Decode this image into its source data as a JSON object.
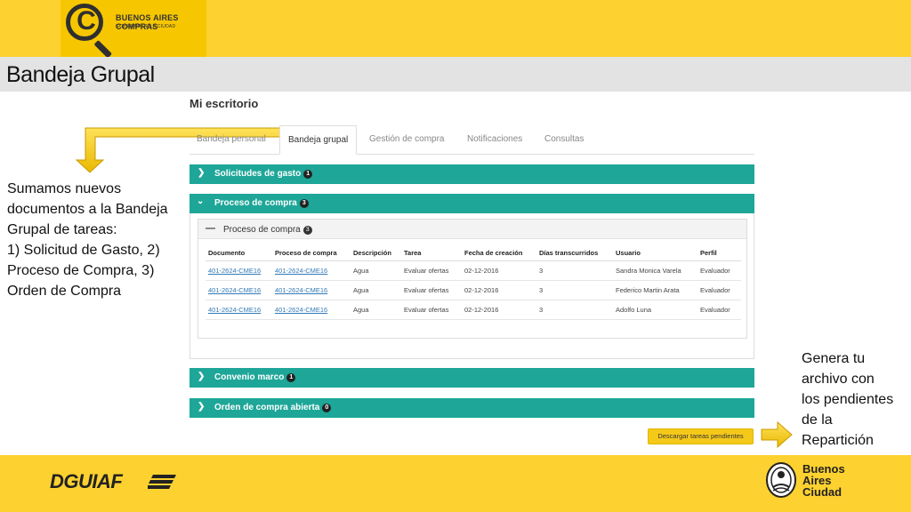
{
  "header": {
    "logo_name": "BUENOS AIRES COMPRAS",
    "logo_sub": "GOBIERNO DE LA CIUDAD",
    "logo_letter": "C"
  },
  "slide_title": "Bandeja Grupal",
  "app": {
    "heading": "Mi escritorio",
    "tabs": [
      {
        "label": "Bandeja personal",
        "active": false
      },
      {
        "label": "Bandeja grupal",
        "active": true
      },
      {
        "label": "Gestión de compra",
        "active": false
      },
      {
        "label": "Notificaciones",
        "active": false
      },
      {
        "label": "Consultas",
        "active": false
      }
    ],
    "panels": [
      {
        "title": "Solicitudes de gasto",
        "count": "1",
        "expanded": false
      },
      {
        "title": "Proceso de compra",
        "count": "3",
        "expanded": true
      },
      {
        "title": "Convenio marco",
        "count": "1",
        "expanded": false
      },
      {
        "title": "Orden de compra abierta",
        "count": "0",
        "expanded": false
      }
    ],
    "inner_panel": {
      "title": "Proceso de compra",
      "count": "3"
    },
    "table": {
      "headers": [
        "Documento",
        "Proceso de compra",
        "Descripción",
        "Tarea",
        "Fecha de creación",
        "Días transcurridos",
        "Usuario",
        "Perfil"
      ],
      "rows": [
        [
          "401-2624-CME16",
          "401-2624-CME16",
          "Agua",
          "Evaluar ofertas",
          "02-12-2016",
          "3",
          "Sandra Monica Varela",
          "Evaluador"
        ],
        [
          "401-2624-CME16",
          "401-2624-CME16",
          "Agua",
          "Evaluar ofertas",
          "02-12-2016",
          "3",
          "Federico Martin Arata",
          "Evaluador"
        ],
        [
          "401-2624-CME16",
          "401-2624-CME16",
          "Agua",
          "Evaluar ofertas",
          "02-12-2016",
          "3",
          "Adolfo Luna",
          "Evaluador"
        ]
      ]
    },
    "download_button": "Descargar tareas pendientes"
  },
  "annotations": {
    "left": [
      "Sumamos nuevos",
      "documentos a la Bandeja",
      "Grupal de tareas:",
      "1) Solicitud de Gasto, 2)",
      "Proceso de Compra, 3)",
      "Orden de Compra"
    ],
    "right": [
      "Genera tu",
      "archivo con",
      "los pendientes",
      "de la",
      "Repartición"
    ]
  },
  "footer": {
    "left_logo": "DGUIAF",
    "right_logo": [
      "Buenos",
      "Aires",
      "Ciudad"
    ]
  },
  "colors": {
    "brand_yellow": "#fdd12f",
    "panel_teal": "#1ea698",
    "link_blue": "#337ab7",
    "title_bar_gray": "#e3e3e3"
  },
  "icons": {
    "panel_collapsed": "chevron-right-icon",
    "panel_expanded": "chevron-down-icon",
    "inner_collapse": "minus-icon",
    "callout_arrows": "arrow-icon"
  }
}
